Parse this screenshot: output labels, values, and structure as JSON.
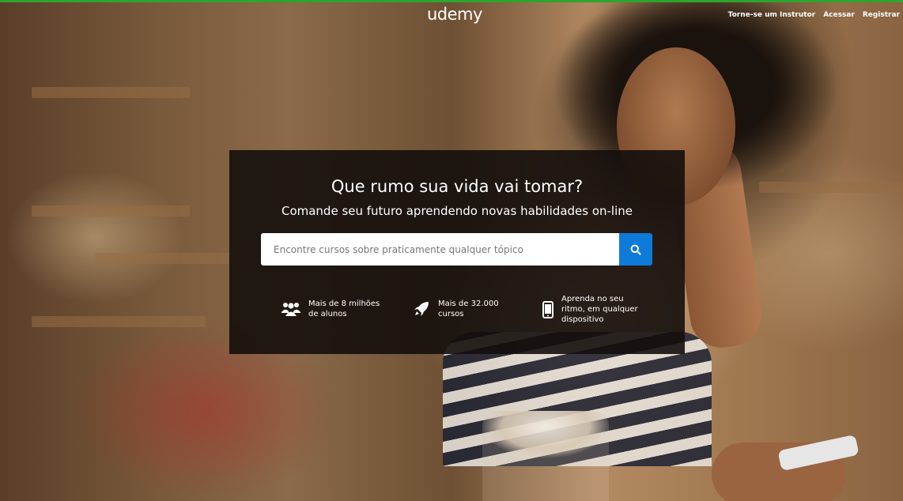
{
  "brand": {
    "logo_text": "udemy",
    "accent_color": "#0f7bd8",
    "top_border_color": "#2ea42e"
  },
  "header": {
    "nav": [
      {
        "label": "Torne-se um Instrutor"
      },
      {
        "label": "Acessar"
      },
      {
        "label": "Registrar"
      }
    ]
  },
  "hero": {
    "title": "Que rumo sua vida vai tomar?",
    "subtitle": "Comande seu futuro aprendendo novas habilidades on-line",
    "search": {
      "placeholder": "Encontre cursos sobre praticamente qualquer tópico",
      "value": "",
      "button_icon": "search-icon"
    },
    "features": [
      {
        "icon": "users-icon",
        "text": "Mais de 8 milhões\nde alunos"
      },
      {
        "icon": "rocket-icon",
        "text": "Mais de 32.000\ncursos"
      },
      {
        "icon": "smartphone-icon",
        "text": "Aprenda no seu\nritmo, em qualquer\ndispositivo"
      }
    ]
  }
}
